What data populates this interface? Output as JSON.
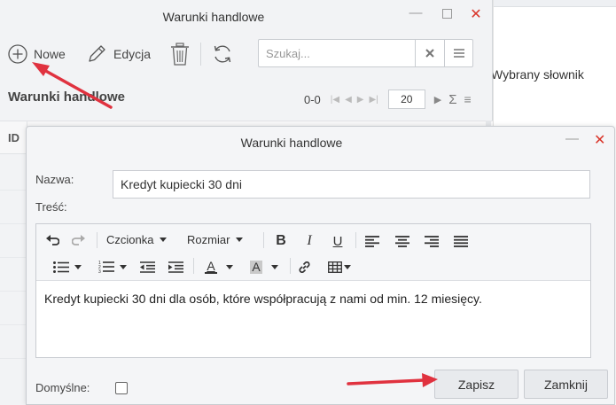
{
  "background_window": {
    "title": "Warunki handlowe",
    "toolbar": {
      "new_label": "Nowe",
      "edit_label": "Edycja"
    },
    "search": {
      "placeholder": "Szukaj..."
    },
    "section_title": "Warunki handlowe",
    "pager": {
      "count": "0-0",
      "page_size": "20"
    },
    "grid": {
      "columns": [
        "ID"
      ]
    }
  },
  "right_panel": {
    "label": "Wybrany słownik"
  },
  "dialog": {
    "title": "Warunki handlowe",
    "name_label": "Nazwa:",
    "name_value": "Kredyt kupiecki 30 dni",
    "content_label": "Treść:",
    "editor": {
      "font_select": "Czcionka",
      "size_select": "Rozmiar",
      "bold": "B",
      "italic": "I",
      "underline": "U",
      "text_color": "A",
      "bg_color": "A",
      "content": "Kredyt kupiecki 30 dni dla osób, które współpracują z nami od min. 12 miesięcy."
    },
    "default_label": "Domyślne:",
    "default_checked": false,
    "save_label": "Zapisz",
    "close_label": "Zamknij"
  },
  "colors": {
    "accent_close": "#d9362b",
    "annotation_arrow": "#e0323f"
  },
  "icons": [
    "plus-circle-icon",
    "pencil-icon",
    "trash-icon",
    "refresh-icon",
    "clear-icon",
    "menu-icon",
    "undo-icon",
    "redo-icon",
    "bullet-list-icon",
    "numbered-list-icon",
    "outdent-icon",
    "indent-icon",
    "link-icon",
    "table-icon",
    "sigma-icon"
  ]
}
